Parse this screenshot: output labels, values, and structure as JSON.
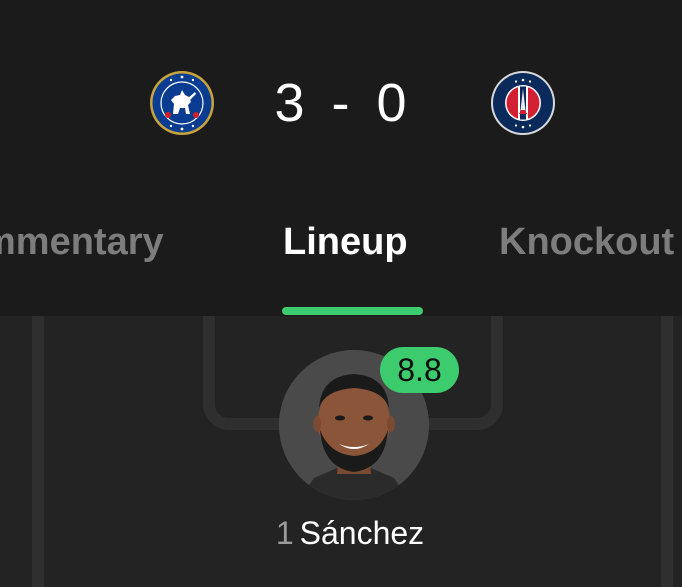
{
  "match": {
    "home_team": "Chelsea",
    "away_team": "Paris Saint-Germain",
    "home_score": "3",
    "separator": "-",
    "away_score": "0"
  },
  "tabs": [
    {
      "label": "mmentary"
    },
    {
      "label": "Lineup"
    },
    {
      "label": "Knockout"
    }
  ],
  "active_tab": "Lineup",
  "player": {
    "number": "1",
    "name": "Sánchez",
    "rating": "8.8"
  },
  "colors": {
    "background": "#1b1b1b",
    "pitch": "#232323",
    "pitch_lines": "#2f2f2f",
    "accent": "#3ccc6d",
    "inactive_tab": "#7d7d7d"
  },
  "icons": {
    "home_crest": "chelsea-crest-icon",
    "away_crest": "psg-crest-icon",
    "avatar": "player-avatar"
  }
}
